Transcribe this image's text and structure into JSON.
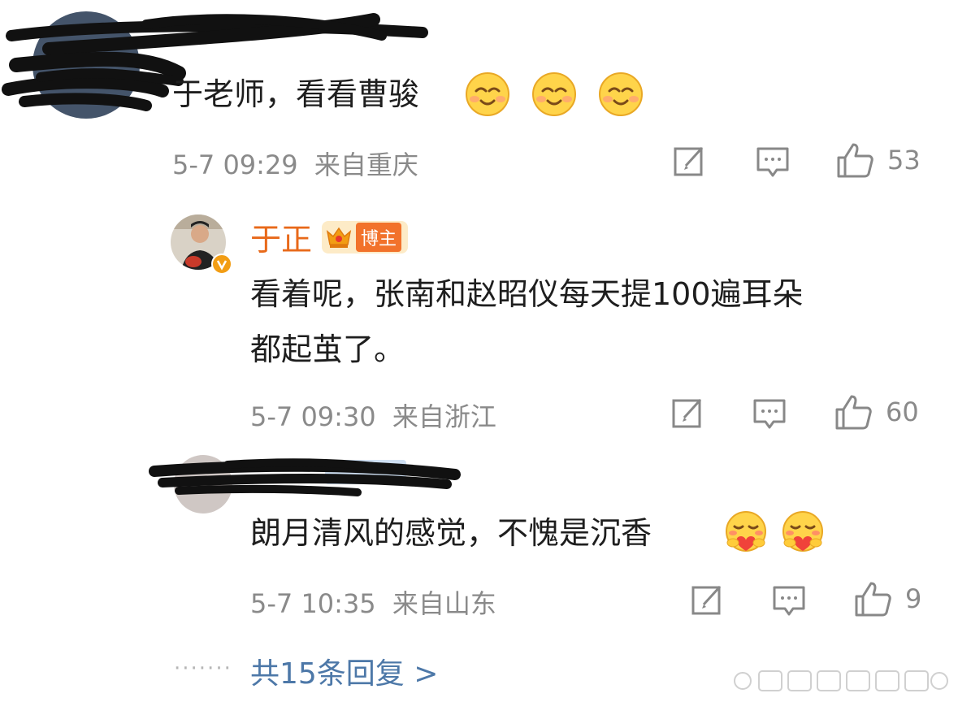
{
  "comments": [
    {
      "text": "于老师，看看曹骏",
      "time": "5-7 09:29",
      "location": "来自重庆",
      "likes": "53",
      "emoji": [
        "smile",
        "smile",
        "smile"
      ]
    },
    {
      "author": "于正",
      "badge": "博主",
      "text_line1": "看着呢，张南和赵昭仪每天提100遍耳朵",
      "text_line2": "都起茧了。",
      "time": "5-7 09:30",
      "location": "来自浙江",
      "likes": "60"
    },
    {
      "text": "朗月清风的感觉，不愧是沉香",
      "time": "5-7 10:35",
      "location": "来自山东",
      "likes": "9",
      "emoji": [
        "hug",
        "hug"
      ]
    }
  ],
  "more_replies": "共15条回复 >",
  "dots": "·······",
  "colors": {
    "name": "#e8691a",
    "link": "#4d78a8",
    "meta": "#8a8a8a"
  }
}
